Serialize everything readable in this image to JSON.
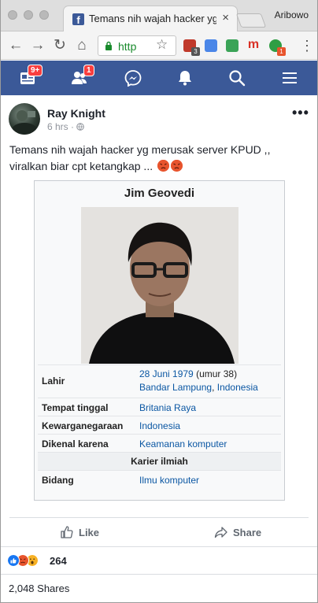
{
  "browser": {
    "tab_title": "Temans nih wajah hacker yg",
    "tab_close_glyph": "×",
    "profile_name": "Aribowo",
    "url_text": "http",
    "nav": {
      "back": "←",
      "forward": "→",
      "reload": "↻",
      "home": "⌂"
    },
    "extensions": [
      {
        "icon": "shield-extension-icon",
        "badge": "3",
        "color": "#c0392b"
      },
      {
        "icon": "google-translate-icon",
        "badge": "",
        "color": "#4a86e8"
      },
      {
        "icon": "download-arrow-icon",
        "badge": "",
        "color": "#3aa357"
      },
      {
        "icon": "m-extension-icon",
        "badge": "",
        "color": "#d93025"
      },
      {
        "icon": "green-extension-icon",
        "badge": "1",
        "color": "#2f9e44"
      }
    ]
  },
  "fb_nav": {
    "feed_badge": "9+",
    "friends_badge": "1",
    "icons": [
      "news-feed-icon",
      "friend-requests-icon",
      "messenger-icon",
      "notifications-icon",
      "search-icon",
      "menu-icon"
    ]
  },
  "post": {
    "author": "Ray Knight",
    "timestamp": "6 hrs",
    "timestamp_sep": " · ",
    "menu_glyph": "•••",
    "text_line1": "Temans nih wajah hacker yg merusak server KPUD ,,",
    "text_line2": "viralkan biar cpt ketangkap ...",
    "infobox": {
      "name": "Jim Geovedi",
      "rows": [
        {
          "label": "Lahir",
          "value_link": "28 Juni 1979",
          "value_plain": " (umur 38)",
          "value_line2_a": "Bandar Lampung",
          "value_line2_sep": ", ",
          "value_line2_b": "Indonesia"
        },
        {
          "label": "Tempat tinggal",
          "value": "Britania Raya"
        },
        {
          "label": "Kewarganegaraan",
          "value": "Indonesia"
        },
        {
          "label": "Dikenal karena",
          "value": "Keamanan komputer"
        },
        {
          "section": "Karier ilmiah"
        },
        {
          "label": "Bidang",
          "value": "Ilmu komputer"
        }
      ]
    },
    "actions": {
      "like": "Like",
      "share": "Share"
    },
    "reaction_count": "264",
    "shares_count": "2,048 Shares",
    "colors": {
      "fb_blue": "#3b5998",
      "link_blue": "#0b57a3",
      "like_blue": "#1877f2",
      "angry": "#e8542d",
      "wow": "#f7b125"
    }
  }
}
